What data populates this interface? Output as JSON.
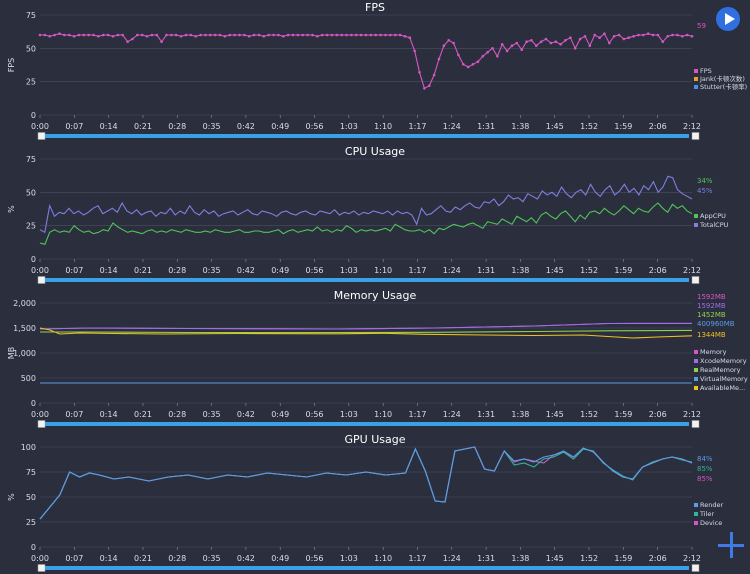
{
  "app": {
    "play_button": "play",
    "add_button": "add"
  },
  "time_ticks": [
    "0:00",
    "0:07",
    "0:14",
    "0:21",
    "0:28",
    "0:35",
    "0:42",
    "0:49",
    "0:56",
    "1:03",
    "1:10",
    "1:17",
    "1:24",
    "1:31",
    "1:38",
    "1:45",
    "1:52",
    "1:59",
    "2:06",
    "2:12"
  ],
  "chart_data": [
    {
      "type": "line",
      "title": "FPS",
      "ylabel": "FPS",
      "ylim": [
        0,
        75
      ],
      "yticks": [
        0,
        25,
        50,
        75
      ],
      "yticklabels": [
        "0",
        "25",
        "50",
        "75"
      ],
      "x_range_seconds": [
        0,
        132
      ],
      "end_labels": [
        {
          "text": "59",
          "color": "#d657c4"
        }
      ],
      "legend": [
        {
          "name": "FPS",
          "color": "#d657c4"
        },
        {
          "name": "Jank(卡顿次数)",
          "color": "#e8a030"
        },
        {
          "name": "Stutter(卡顿率)",
          "color": "#4a90e8"
        }
      ],
      "markers": true,
      "series": [
        {
          "name": "FPS",
          "color": "#d657c4",
          "values": [
            60,
            60,
            59,
            60,
            61,
            60,
            60,
            59,
            60,
            60,
            60,
            60,
            59,
            60,
            60,
            59,
            60,
            60,
            55,
            57,
            60,
            60,
            59,
            60,
            60,
            55,
            60,
            60,
            60,
            59,
            60,
            60,
            59,
            60,
            60,
            60,
            60,
            60,
            59,
            60,
            60,
            60,
            60,
            59,
            60,
            60,
            59,
            60,
            60,
            60,
            59,
            60,
            60,
            60,
            60,
            60,
            60,
            59,
            60,
            60,
            60,
            60,
            60,
            60,
            60,
            60,
            60,
            60,
            60,
            60,
            60,
            60,
            60,
            60,
            60,
            59,
            58,
            48,
            32,
            20,
            22,
            30,
            42,
            52,
            56,
            54,
            45,
            38,
            36,
            38,
            40,
            44,
            47,
            50,
            44,
            53,
            48,
            52,
            54,
            49,
            55,
            56,
            52,
            55,
            57,
            54,
            55,
            53,
            56,
            58,
            50,
            57,
            59,
            52,
            60,
            58,
            61,
            54,
            59,
            60,
            57,
            58,
            59,
            60,
            60,
            61,
            60,
            60,
            55,
            59,
            60,
            60,
            59,
            60,
            59
          ]
        }
      ]
    },
    {
      "type": "line",
      "title": "CPU Usage",
      "ylabel": "%",
      "ylim": [
        0,
        75
      ],
      "yticks": [
        0,
        25,
        50,
        75
      ],
      "yticklabels": [
        "0",
        "25",
        "50",
        "75"
      ],
      "x_range_seconds": [
        0,
        132
      ],
      "end_labels": [
        {
          "text": "34%",
          "color": "#4fc45a"
        },
        {
          "name": "",
          "text": "45%",
          "color": "#7f7fe0"
        }
      ],
      "legend": [
        {
          "name": "AppCPU",
          "color": "#4fc45a"
        },
        {
          "name": "TotalCPU",
          "color": "#7f7fe0"
        }
      ],
      "series": [
        {
          "name": "AppCPU",
          "color": "#4fc45a",
          "values": [
            12,
            11,
            20,
            22,
            20,
            21,
            20,
            25,
            22,
            20,
            21,
            19,
            20,
            22,
            21,
            27,
            24,
            22,
            20,
            21,
            20,
            19,
            21,
            22,
            20,
            21,
            20,
            22,
            21,
            20,
            22,
            21,
            20,
            20,
            21,
            20,
            22,
            21,
            20,
            20,
            21,
            22,
            20,
            20,
            21,
            21,
            20,
            20,
            21,
            22,
            19,
            21,
            22,
            20,
            21,
            22,
            21,
            24,
            21,
            22,
            20,
            22,
            21,
            25,
            23,
            20,
            22,
            21,
            22,
            21,
            22,
            23,
            21,
            26,
            24,
            22,
            21,
            21,
            22,
            20,
            22,
            19,
            23,
            22,
            24,
            26,
            25,
            24,
            26,
            27,
            25,
            23,
            28,
            27,
            26,
            30,
            28,
            26,
            32,
            30,
            28,
            31,
            27,
            33,
            35,
            32,
            30,
            34,
            36,
            32,
            28,
            33,
            30,
            35,
            36,
            34,
            38,
            35,
            33,
            36,
            40,
            37,
            34,
            38,
            36,
            35,
            39,
            42,
            38,
            35,
            41,
            38,
            40,
            36,
            34
          ]
        },
        {
          "name": "TotalCPU",
          "color": "#7f7fe0",
          "values": [
            22,
            20,
            40,
            32,
            35,
            34,
            38,
            34,
            36,
            33,
            35,
            38,
            40,
            34,
            36,
            38,
            35,
            42,
            36,
            34,
            37,
            33,
            35,
            36,
            32,
            35,
            34,
            38,
            33,
            36,
            34,
            40,
            35,
            33,
            37,
            34,
            36,
            32,
            34,
            35,
            36,
            33,
            35,
            37,
            34,
            33,
            36,
            35,
            34,
            32,
            35,
            36,
            34,
            33,
            35,
            36,
            34,
            33,
            36,
            35,
            34,
            37,
            33,
            35,
            34,
            36,
            33,
            35,
            34,
            36,
            35,
            34,
            36,
            33,
            36,
            34,
            35,
            33,
            26,
            38,
            33,
            34,
            37,
            40,
            36,
            35,
            39,
            37,
            40,
            42,
            39,
            38,
            43,
            42,
            45,
            40,
            43,
            48,
            45,
            46,
            43,
            49,
            47,
            45,
            51,
            48,
            50,
            47,
            54,
            49,
            46,
            50,
            52,
            48,
            56,
            50,
            47,
            52,
            55,
            48,
            51,
            56,
            50,
            53,
            48,
            55,
            52,
            58,
            50,
            54,
            62,
            61,
            52,
            49,
            47,
            45
          ]
        }
      ]
    },
    {
      "type": "line",
      "title": "Memory Usage",
      "ylabel": "MB",
      "ylim": [
        0,
        2000
      ],
      "yticks": [
        0,
        500,
        1000,
        1500,
        2000
      ],
      "yticklabels": [
        "0",
        "500",
        "1,000",
        "1,500",
        "2,000"
      ],
      "x_range_seconds": [
        0,
        132
      ],
      "end_labels": [
        {
          "text": "1592MB",
          "color": "#d657c4"
        },
        {
          "text": "1592MB",
          "color": "#9b6fe6"
        },
        {
          "text": "1452MB",
          "color": "#8fd14f"
        },
        {
          "text": "400960MB",
          "color": "#5b9be8"
        },
        {
          "text": "1344MB",
          "color": "#f0c020"
        }
      ],
      "legend": [
        {
          "name": "Memory",
          "color": "#d657c4"
        },
        {
          "name": "XcodeMemory",
          "color": "#9b6fe6"
        },
        {
          "name": "RealMemory",
          "color": "#8fd14f"
        },
        {
          "name": "VirtualMemory",
          "color": "#5b9be8"
        },
        {
          "name": "AvailableMe...",
          "color": "#f0c020"
        }
      ],
      "series": [
        {
          "name": "Memory",
          "color": "#d657c4",
          "x": [
            0,
            10,
            30,
            60,
            80,
            100,
            115,
            132
          ],
          "values": [
            1480,
            1500,
            1490,
            1480,
            1500,
            1540,
            1590,
            1592
          ]
        },
        {
          "name": "XcodeMemory",
          "color": "#9b6fe6",
          "x": [
            0,
            10,
            30,
            60,
            80,
            100,
            115,
            132
          ],
          "values": [
            1480,
            1500,
            1490,
            1480,
            1500,
            1540,
            1590,
            1592
          ]
        },
        {
          "name": "RealMemory",
          "color": "#8fd14f",
          "x": [
            0,
            10,
            30,
            60,
            80,
            100,
            115,
            132
          ],
          "values": [
            1420,
            1420,
            1410,
            1410,
            1415,
            1430,
            1445,
            1452
          ]
        },
        {
          "name": "VirtualMemory",
          "color": "#5b9be8",
          "x": [
            0,
            132
          ],
          "values": [
            400,
            400
          ]
        },
        {
          "name": "AvailableMemory",
          "color": "#f0c020",
          "x": [
            0,
            2,
            4,
            8,
            15,
            25,
            40,
            60,
            70,
            78,
            90,
            100,
            110,
            115,
            120,
            125,
            132
          ],
          "values": [
            1500,
            1460,
            1380,
            1400,
            1390,
            1380,
            1390,
            1385,
            1395,
            1375,
            1360,
            1350,
            1360,
            1330,
            1300,
            1320,
            1344
          ]
        }
      ]
    },
    {
      "type": "line",
      "title": "GPU Usage",
      "ylabel": "%",
      "ylim": [
        0,
        100
      ],
      "yticks": [
        0,
        25,
        50,
        75,
        100
      ],
      "yticklabels": [
        "0",
        "25",
        "50",
        "75",
        "100"
      ],
      "x_range_seconds": [
        0,
        132
      ],
      "end_labels": [
        {
          "text": "84%",
          "color": "#5b9be8"
        },
        {
          "text": "85%",
          "color": "#2fb59a"
        },
        {
          "text": "85%",
          "color": "#d657c4"
        }
      ],
      "legend": [
        {
          "name": "Render",
          "color": "#5b9be8"
        },
        {
          "name": "Tiler",
          "color": "#2fb59a"
        },
        {
          "name": "Device",
          "color": "#d657c4"
        }
      ],
      "series": [
        {
          "name": "Device",
          "color": "#d657c4",
          "x": [
            0,
            2,
            4,
            6,
            8,
            10,
            12,
            15,
            18,
            22,
            26,
            30,
            34,
            38,
            42,
            46,
            50,
            54,
            58,
            62,
            66,
            70,
            74,
            76,
            78,
            80,
            82,
            84,
            86,
            88,
            90,
            92,
            94,
            96,
            98,
            100,
            102,
            104,
            106,
            108,
            110,
            112,
            114,
            116,
            118,
            120,
            122,
            124,
            126,
            128,
            130,
            132
          ],
          "values": [
            28,
            40,
            52,
            75,
            70,
            74,
            72,
            68,
            70,
            66,
            70,
            72,
            68,
            72,
            70,
            74,
            72,
            70,
            74,
            72,
            75,
            72,
            74,
            98,
            76,
            46,
            45,
            96,
            98,
            100,
            78,
            76,
            96,
            85,
            88,
            86,
            84,
            92,
            95,
            90,
            98,
            96,
            85,
            76,
            70,
            68,
            80,
            84,
            88,
            90,
            88,
            84
          ]
        },
        {
          "name": "Tiler",
          "color": "#2fb59a",
          "x": [
            0,
            2,
            4,
            6,
            8,
            10,
            12,
            15,
            18,
            22,
            26,
            30,
            34,
            38,
            42,
            46,
            50,
            54,
            58,
            62,
            66,
            70,
            74,
            76,
            78,
            80,
            82,
            84,
            86,
            88,
            90,
            92,
            94,
            96,
            98,
            100,
            102,
            104,
            106,
            108,
            110,
            112,
            114,
            116,
            118,
            120,
            122,
            124,
            126,
            128,
            130,
            132
          ],
          "values": [
            28,
            40,
            52,
            75,
            70,
            74,
            72,
            68,
            70,
            66,
            70,
            72,
            68,
            72,
            70,
            74,
            72,
            70,
            74,
            72,
            75,
            72,
            74,
            98,
            76,
            46,
            45,
            96,
            98,
            100,
            78,
            76,
            96,
            82,
            84,
            80,
            88,
            90,
            95,
            88,
            98,
            96,
            84,
            77,
            71,
            67,
            80,
            85,
            88,
            90,
            87,
            85
          ]
        },
        {
          "name": "Render",
          "color": "#5b9be8",
          "x": [
            0,
            2,
            4,
            6,
            8,
            10,
            12,
            15,
            18,
            22,
            26,
            30,
            34,
            38,
            42,
            46,
            50,
            54,
            58,
            62,
            66,
            70,
            74,
            76,
            78,
            80,
            82,
            84,
            86,
            88,
            90,
            92,
            94,
            96,
            98,
            100,
            102,
            104,
            106,
            108,
            110,
            112,
            114,
            116,
            118,
            120,
            122,
            124,
            126,
            128,
            130,
            132
          ],
          "values": [
            28,
            40,
            52,
            75,
            70,
            74,
            72,
            68,
            70,
            66,
            70,
            72,
            68,
            72,
            70,
            74,
            72,
            70,
            74,
            72,
            75,
            72,
            74,
            98,
            76,
            46,
            45,
            96,
            98,
            100,
            78,
            76,
            96,
            86,
            88,
            85,
            90,
            92,
            96,
            90,
            99,
            95,
            85,
            76,
            70,
            68,
            80,
            84,
            88,
            90,
            88,
            84
          ]
        }
      ]
    }
  ]
}
